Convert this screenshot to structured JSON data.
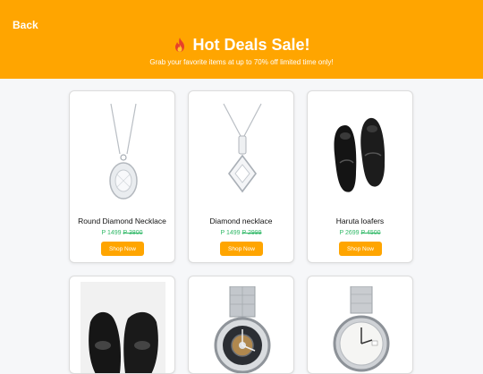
{
  "header": {
    "back_label": "Back",
    "title": "Hot Deals Sale!",
    "subtitle": "Grab your favorite items at up to 70% off limited time only!",
    "title_icon": "fire-icon"
  },
  "colors": {
    "accent": "#ffa500",
    "price": "#2fb866"
  },
  "products": [
    {
      "name": "Round Diamond Necklace",
      "price": "P 1499",
      "old_price": "P 3800",
      "cta": "Shop Now",
      "image_icon": "pendant-necklace-icon"
    },
    {
      "name": "Diamond necklace",
      "price": "P 1499",
      "old_price": "P 2999",
      "cta": "Shop Now",
      "image_icon": "diamond-pendant-icon"
    },
    {
      "name": "Haruta loafers",
      "price": "P 2699",
      "old_price": "P 4500",
      "cta": "Shop Now",
      "image_icon": "loafers-icon"
    },
    {
      "name": "",
      "price": "",
      "old_price": "",
      "cta": "",
      "image_icon": "loafers-icon"
    },
    {
      "name": "",
      "price": "",
      "old_price": "",
      "cta": "",
      "image_icon": "skeleton-watch-icon"
    },
    {
      "name": "",
      "price": "",
      "old_price": "",
      "cta": "",
      "image_icon": "silver-watch-icon"
    }
  ]
}
